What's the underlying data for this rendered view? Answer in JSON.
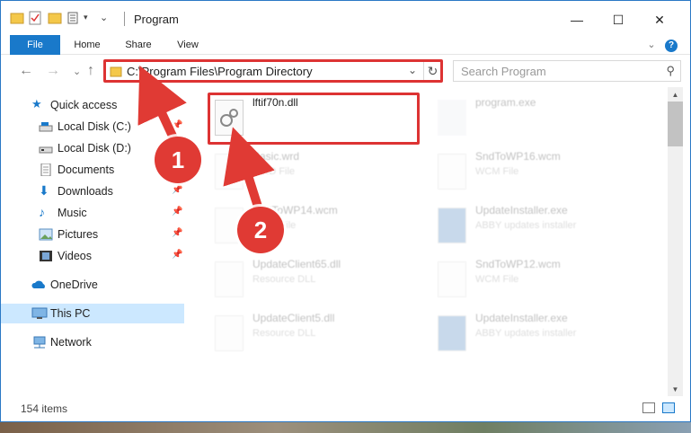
{
  "window": {
    "title": "Program"
  },
  "controls": {
    "minimize": "—",
    "maximize": "☐",
    "close": "✕"
  },
  "ribbon": {
    "tabs": [
      {
        "label": "File"
      },
      {
        "label": "Home"
      },
      {
        "label": "Share"
      },
      {
        "label": "View"
      }
    ],
    "expand": "⌄",
    "help": "?"
  },
  "nav": {
    "back": "←",
    "forward": "→",
    "recent": "⌄",
    "up": "↑"
  },
  "address": {
    "path": "C:\\Program Files\\Program Directory"
  },
  "search": {
    "placeholder": "Search Program"
  },
  "sidebar": {
    "items": [
      {
        "label": "Quick access",
        "icon": "star-icon"
      },
      {
        "label": "Local Disk (C:)",
        "icon": "drive-icon"
      },
      {
        "label": "Local Disk (D:)",
        "icon": "drive-icon"
      },
      {
        "label": "Documents",
        "icon": "documents-icon"
      },
      {
        "label": "Downloads",
        "icon": "download-icon"
      },
      {
        "label": "Music",
        "icon": "music-icon"
      },
      {
        "label": "Pictures",
        "icon": "pictures-icon"
      },
      {
        "label": "Videos",
        "icon": "videos-icon"
      },
      {
        "label": "OneDrive",
        "icon": "cloud-icon"
      },
      {
        "label": "This PC",
        "icon": "computer-icon"
      },
      {
        "label": "Network",
        "icon": "network-icon"
      }
    ]
  },
  "files": [
    {
      "name": "lftif70n.dll",
      "type": ""
    },
    {
      "name": "program.exe",
      "type": ""
    },
    {
      "name": "Basic.wrd",
      "type": "WRD File"
    },
    {
      "name": "SndToWP16.wcm",
      "type": "WCM File"
    },
    {
      "name": "SndToWP14.wcm",
      "type": "WCM File"
    },
    {
      "name": "UpdateInstaller.exe",
      "type": "ABBY updates installer"
    },
    {
      "name": "UpdateClient65.dll",
      "type": "Resource DLL"
    },
    {
      "name": "SndToWP12.wcm",
      "type": "WCM File"
    },
    {
      "name": "UpdateClient5.dll",
      "type": "Resource DLL"
    },
    {
      "name": "UpdateInstaller.exe",
      "type": "ABBY updates installer"
    }
  ],
  "status": {
    "items": "154 items"
  },
  "steps": {
    "one": "1",
    "two": "2"
  },
  "colors": {
    "accent": "#1979ca",
    "highlight": "#dd3333",
    "selection": "#cce8ff"
  }
}
